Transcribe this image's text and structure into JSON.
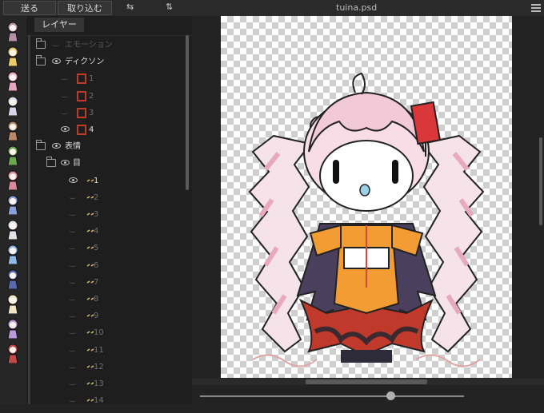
{
  "toolbar": {
    "send_label": "送る",
    "import_label": "取り込む",
    "flip_h_icon": "flip-horizontal-icon",
    "flip_v_icon": "flip-vertical-icon",
    "menu_icon": "hamburger-menu-icon"
  },
  "window": {
    "title": "tuina.psd"
  },
  "layer_panel": {
    "tab_label": "レイヤー",
    "rows": [
      {
        "type": "folder",
        "label": "エモーション",
        "visible": false,
        "dim": true
      },
      {
        "type": "folder",
        "label": "ディクソン",
        "visible": true
      },
      {
        "type": "layer",
        "label": "1",
        "visible": false
      },
      {
        "type": "layer",
        "label": "2",
        "visible": false
      },
      {
        "type": "layer",
        "label": "3",
        "visible": false
      },
      {
        "type": "layer",
        "label": "4",
        "visible": true
      },
      {
        "type": "folder",
        "label": "表情",
        "visible": true
      },
      {
        "type": "folder",
        "label": "目",
        "visible": true
      },
      {
        "type": "layer",
        "label": "1",
        "visible": true
      },
      {
        "type": "layer",
        "label": "2",
        "visible": false
      },
      {
        "type": "layer",
        "label": "3",
        "visible": false
      },
      {
        "type": "layer",
        "label": "4",
        "visible": false
      },
      {
        "type": "layer",
        "label": "5",
        "visible": false
      },
      {
        "type": "layer",
        "label": "6",
        "visible": false
      },
      {
        "type": "layer",
        "label": "7",
        "visible": false
      },
      {
        "type": "layer",
        "label": "8",
        "visible": false
      },
      {
        "type": "layer",
        "label": "9",
        "visible": false
      },
      {
        "type": "layer",
        "label": "10",
        "visible": false
      },
      {
        "type": "layer",
        "label": "11",
        "visible": false
      },
      {
        "type": "layer",
        "label": "12",
        "visible": false
      },
      {
        "type": "layer",
        "label": "13",
        "visible": false
      },
      {
        "type": "layer",
        "label": "14",
        "visible": false
      }
    ]
  },
  "colors": {
    "panel_bg": "#1e1e1e",
    "canvas_area_bg": "#232323",
    "toolbar_bg": "#2a2a2a",
    "hair_pink": "#f2c9d6",
    "robe_dark": "#4a3f5c",
    "robe_red": "#c0392b",
    "orange": "#f39c33"
  },
  "view": {
    "zoom_fraction": 0.72
  }
}
